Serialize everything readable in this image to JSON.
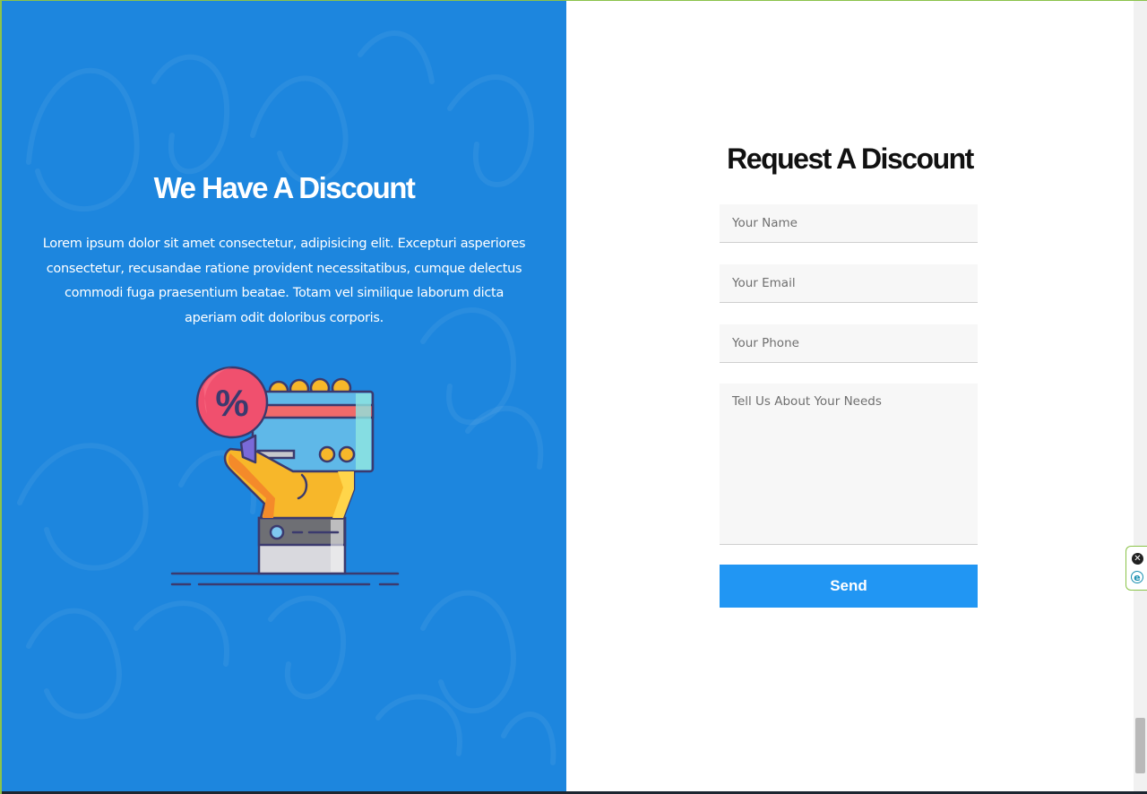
{
  "left_panel": {
    "title": "We Have A Discount",
    "body": "Lorem ipsum dolor sit amet consectetur, adipisicing elit. Excepturi asperiores consectetur, recusandae ratione provident necessitatibus, cumque delectus commodi fuga praesentium beatae. Totam vel similique laborum dicta aperiam odit doloribus corporis.",
    "illustration_icon": "hand-holding-discount-card-icon",
    "badge_symbol": "%",
    "accent_color": "#1d86de"
  },
  "form": {
    "title": "Request A Discount",
    "name_placeholder": "Your Name",
    "email_placeholder": "Your Email",
    "phone_placeholder": "Your Phone",
    "needs_placeholder": "Tell Us About Your Needs",
    "send_label": "Send",
    "button_color": "#2196f3"
  },
  "extension_widget": {
    "close_symbol": "✕",
    "logo_letter": "e"
  }
}
